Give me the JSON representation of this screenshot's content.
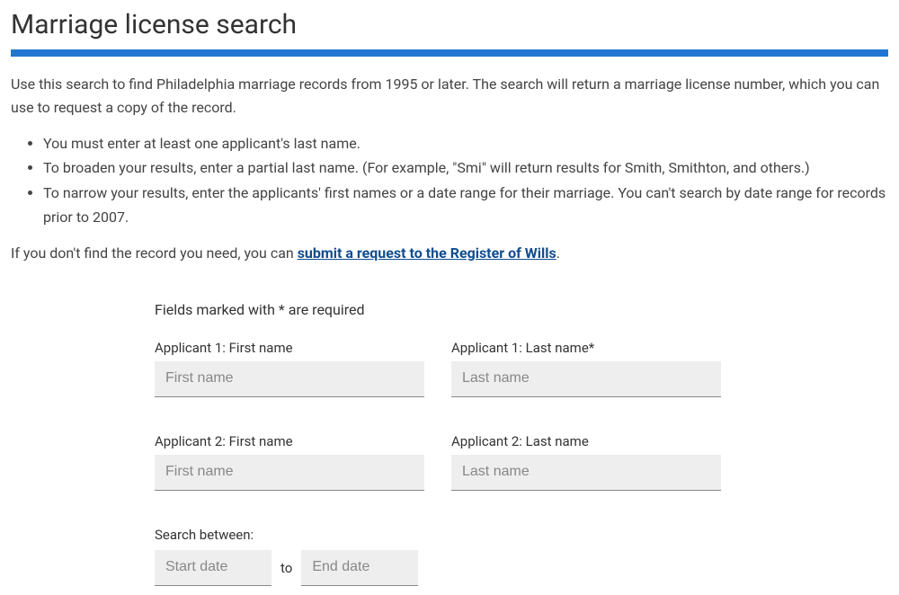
{
  "header": {
    "title": "Marriage license search"
  },
  "intro": {
    "paragraph": "Use this search to find Philadelphia marriage records from 1995 or later. The search will return a marriage license number, which you can use to request a copy of the record.",
    "bullets": [
      "You must enter at least one applicant's last name.",
      "To broaden your results, enter a partial last name. (For example, \"Smi\" will return results for Smith, Smithton, and others.)",
      "To narrow your results, enter the applicants' first names or a date range for their marriage. You can't search by date range for records prior to 2007."
    ],
    "fallback_prefix": "If you don't find the record you need, you can ",
    "fallback_link": "submit a request to the Register of Wills",
    "fallback_suffix": "."
  },
  "form": {
    "required_note": "Fields marked with * are required",
    "applicant1": {
      "first_label": "Applicant 1: First name",
      "first_placeholder": "First name",
      "last_label": "Applicant 1: Last name*",
      "last_placeholder": "Last name"
    },
    "applicant2": {
      "first_label": "Applicant 2: First name",
      "first_placeholder": "First name",
      "last_label": "Applicant 2: Last name",
      "last_placeholder": "Last name"
    },
    "date_range": {
      "label": "Search between:",
      "start_placeholder": "Start date",
      "separator": "to",
      "end_placeholder": "End date"
    }
  }
}
